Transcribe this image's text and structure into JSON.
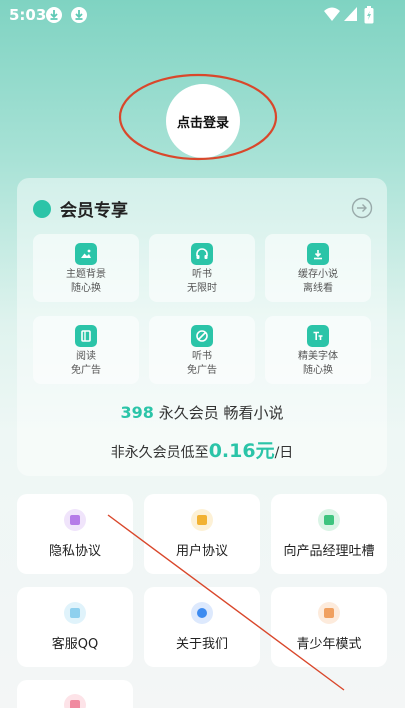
{
  "status_bar": {
    "time": "5:03"
  },
  "profile": {
    "login_label": "点击登录"
  },
  "member": {
    "title": "会员专享",
    "perks": [
      {
        "line1": "主题背景",
        "line2": "随心换"
      },
      {
        "line1": "听书",
        "line2": "无限时"
      },
      {
        "line1": "缓存小说",
        "line2": "离线看"
      },
      {
        "line1": "阅读",
        "line2": "免广告"
      },
      {
        "line1": "听书",
        "line2": "免广告"
      },
      {
        "line1": "精美字体",
        "line2": "随心换"
      }
    ],
    "promo_price": "398",
    "promo_text": "永久会员 畅看小说",
    "promo2_prefix": "非永久会员低至",
    "promo2_price": "0.16元",
    "promo2_suffix": "/日"
  },
  "menu": [
    {
      "label": "隐私协议",
      "color": "#b57be8"
    },
    {
      "label": "用户协议",
      "color": "#f2b233"
    },
    {
      "label": "向产品经理吐槽",
      "color": "#3ec47f"
    },
    {
      "label": "客服QQ",
      "color": "#8fd0ee"
    },
    {
      "label": "关于我们",
      "color": "#3d8bf0"
    },
    {
      "label": "青少年模式",
      "color": "#f0a060"
    }
  ],
  "colors": {
    "accent": "#2bc4a8",
    "annotation": "#d9472b"
  }
}
